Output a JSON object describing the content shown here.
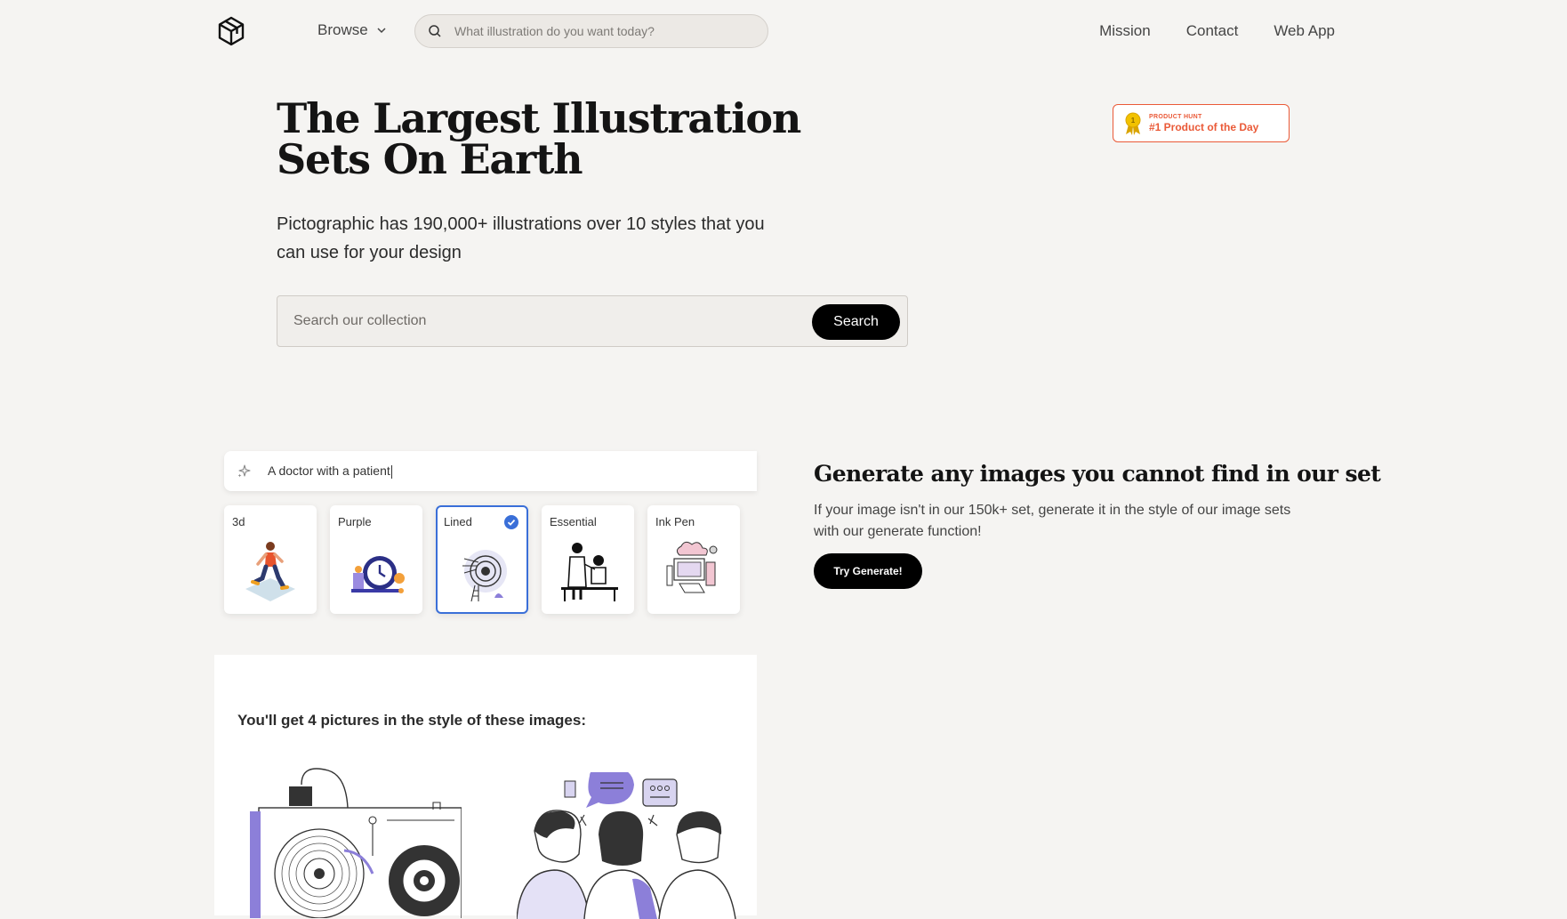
{
  "nav": {
    "browse_label": "Browse",
    "search_placeholder": "What illustration do you want today?",
    "links": [
      "Mission",
      "Contact",
      "Web App"
    ]
  },
  "hero": {
    "title": "The Largest Illustration Sets On Earth",
    "subtitle": "Pictographic has 190,000+ illustrations over 10 styles that you can use for your design",
    "search_placeholder": "Search our collection",
    "search_button": "Search"
  },
  "badge": {
    "small": "PRODUCT HUNT",
    "big": "#1 Product of the Day",
    "color": "#ea5a38"
  },
  "demo": {
    "prompt": "A doctor with a patient",
    "styles": [
      "3d",
      "Purple",
      "Lined",
      "Essential",
      "Ink Pen"
    ],
    "selected_style": "Lined",
    "preview_heading": "You'll get 4 pictures in the style of these images:"
  },
  "generate": {
    "title": "Generate any images you cannot find in our set",
    "subtitle": "If your image isn't in our 150k+ set, generate it in the style of our image sets with our generate function!",
    "button": "Try Generate!"
  },
  "colors": {
    "background": "#f5f4f2",
    "accent_blue": "#3a6fd8",
    "accent_purple": "#8c7fd9"
  }
}
